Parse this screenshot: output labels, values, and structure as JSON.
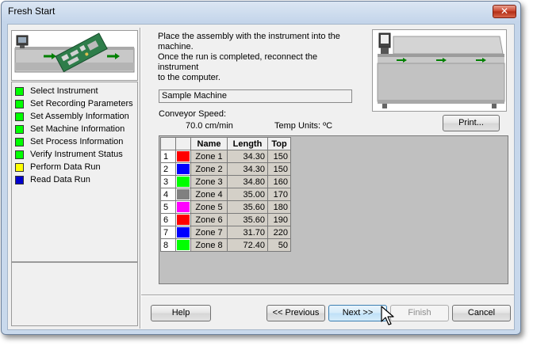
{
  "window": {
    "title": "Fresh Start",
    "close_label": "✕"
  },
  "steps": [
    {
      "label": "Select Instrument",
      "color": "#00ff00"
    },
    {
      "label": "Set Recording Parameters",
      "color": "#00ff00"
    },
    {
      "label": "Set Assembly Information",
      "color": "#00ff00"
    },
    {
      "label": "Set Machine Information",
      "color": "#00ff00"
    },
    {
      "label": "Set Process Information",
      "color": "#00ff00"
    },
    {
      "label": "Verify Instrument Status",
      "color": "#00ff00"
    },
    {
      "label": "Perform Data Run",
      "color": "#ffff00"
    },
    {
      "label": "Read Data Run",
      "color": "#0000cc"
    }
  ],
  "instructions": {
    "line1": "Place the assembly with the instrument into the",
    "line2": "machine.",
    "line3": "Once the run is completed, reconnect the instrument",
    "line4": "to the computer."
  },
  "machine": {
    "name": "Sample Machine",
    "conveyor_label": "Conveyor Speed:",
    "conveyor_speed": "70.0 cm/min",
    "temp_units": "Temp Units: ºC"
  },
  "buttons": {
    "print": "Print...",
    "help": "Help",
    "previous": "<< Previous",
    "next": "Next >>",
    "finish": "Finish",
    "cancel": "Cancel"
  },
  "zone_table": {
    "headers": [
      "",
      "",
      "Name",
      "Length",
      "Top"
    ],
    "rows": [
      {
        "index": "1",
        "color": "#ff0000",
        "name": "Zone 1",
        "length": "34.30",
        "top": "150"
      },
      {
        "index": "2",
        "color": "#0000ff",
        "name": "Zone 2",
        "length": "34.30",
        "top": "150"
      },
      {
        "index": "3",
        "color": "#00ff00",
        "name": "Zone 3",
        "length": "34.80",
        "top": "160"
      },
      {
        "index": "4",
        "color": "#808080",
        "name": "Zone 4",
        "length": "35.00",
        "top": "170"
      },
      {
        "index": "5",
        "color": "#ff00ff",
        "name": "Zone 5",
        "length": "35.60",
        "top": "180"
      },
      {
        "index": "6",
        "color": "#ff0000",
        "name": "Zone 6",
        "length": "35.60",
        "top": "190"
      },
      {
        "index": "7",
        "color": "#0000ff",
        "name": "Zone 7",
        "length": "31.70",
        "top": "220"
      },
      {
        "index": "8",
        "color": "#00ff00",
        "name": "Zone 8",
        "length": "72.40",
        "top": "50"
      }
    ]
  },
  "icons": {
    "left_image": "instrument-board-icon",
    "machine_image": "reflow-oven-icon",
    "cursor": "mouse-pointer-icon"
  }
}
